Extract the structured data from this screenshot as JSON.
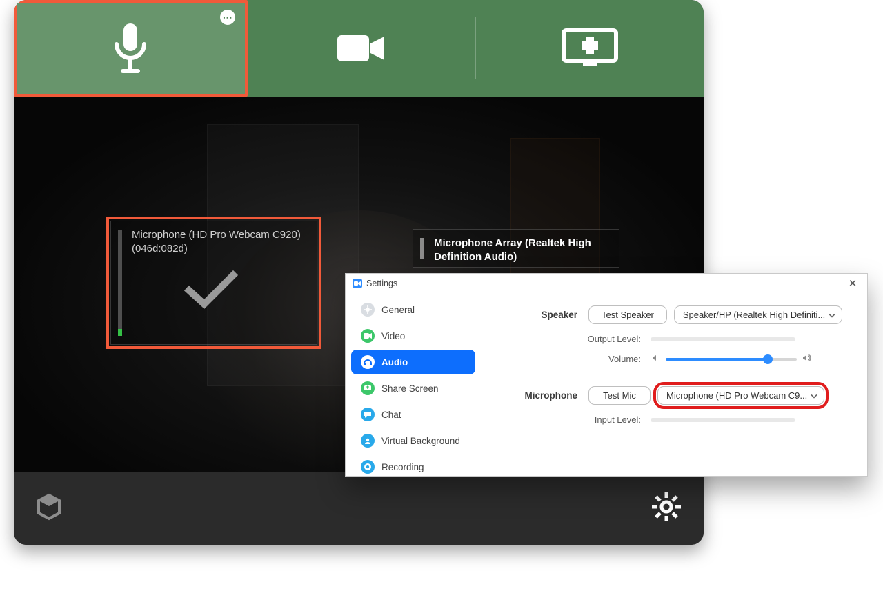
{
  "toolbar": {
    "items": [
      {
        "name": "audio-tab",
        "icon": "microphone-icon",
        "active": true
      },
      {
        "name": "video-tab",
        "icon": "video-camera-icon",
        "active": false
      },
      {
        "name": "share-tab",
        "icon": "share-screen-icon",
        "active": false
      }
    ]
  },
  "mic_cards": {
    "selected": {
      "line1": "Microphone (HD Pro Webcam C920)",
      "line2": "(046d:082d)"
    },
    "other": {
      "line1": "Microphone Array (Realtek High Definition Audio)"
    }
  },
  "settings": {
    "title": "Settings",
    "nav": {
      "general": "General",
      "video": "Video",
      "audio": "Audio",
      "share": "Share Screen",
      "chat": "Chat",
      "vb": "Virtual Background",
      "rec": "Recording"
    },
    "speaker": {
      "label": "Speaker",
      "test_btn": "Test Speaker",
      "device": "Speaker/HP (Realtek High Definiti...",
      "output_level_label": "Output Level:",
      "volume_label": "Volume:",
      "volume_percent": 78
    },
    "microphone": {
      "label": "Microphone",
      "test_btn": "Test Mic",
      "device": "Microphone (HD Pro Webcam C9...",
      "input_level_label": "Input Level:"
    }
  }
}
